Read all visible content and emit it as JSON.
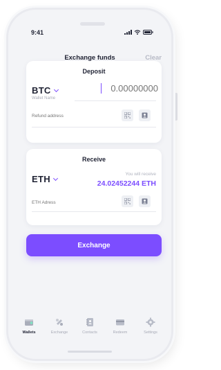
{
  "status": {
    "time": "9:41"
  },
  "header": {
    "title": "Exchange funds",
    "clear_label": "Clear"
  },
  "deposit": {
    "title": "Deposit",
    "coin": "BTC",
    "wallet_label": "Wallet Name",
    "amount_placeholder": "0.00000000",
    "refund_placeholder": "Refund address"
  },
  "receive": {
    "title": "Receive",
    "coin": "ETH",
    "you_will_receive_label": "You will receive",
    "amount": "24.02452244 ETH",
    "address_placeholder": "ETH Adress"
  },
  "action": {
    "exchange_label": "Exchange"
  },
  "tabs": [
    {
      "label": "Wallets",
      "icon": "wallet-icon",
      "active": true
    },
    {
      "label": "Exchange",
      "icon": "exchange-icon",
      "active": false
    },
    {
      "label": "Contacts",
      "icon": "contacts-icon",
      "active": false
    },
    {
      "label": "Redeem",
      "icon": "card-icon",
      "active": false
    },
    {
      "label": "Settings",
      "icon": "gear-icon",
      "active": false
    }
  ],
  "colors": {
    "accent": "#7c4dff",
    "background": "#f3f4f7"
  }
}
